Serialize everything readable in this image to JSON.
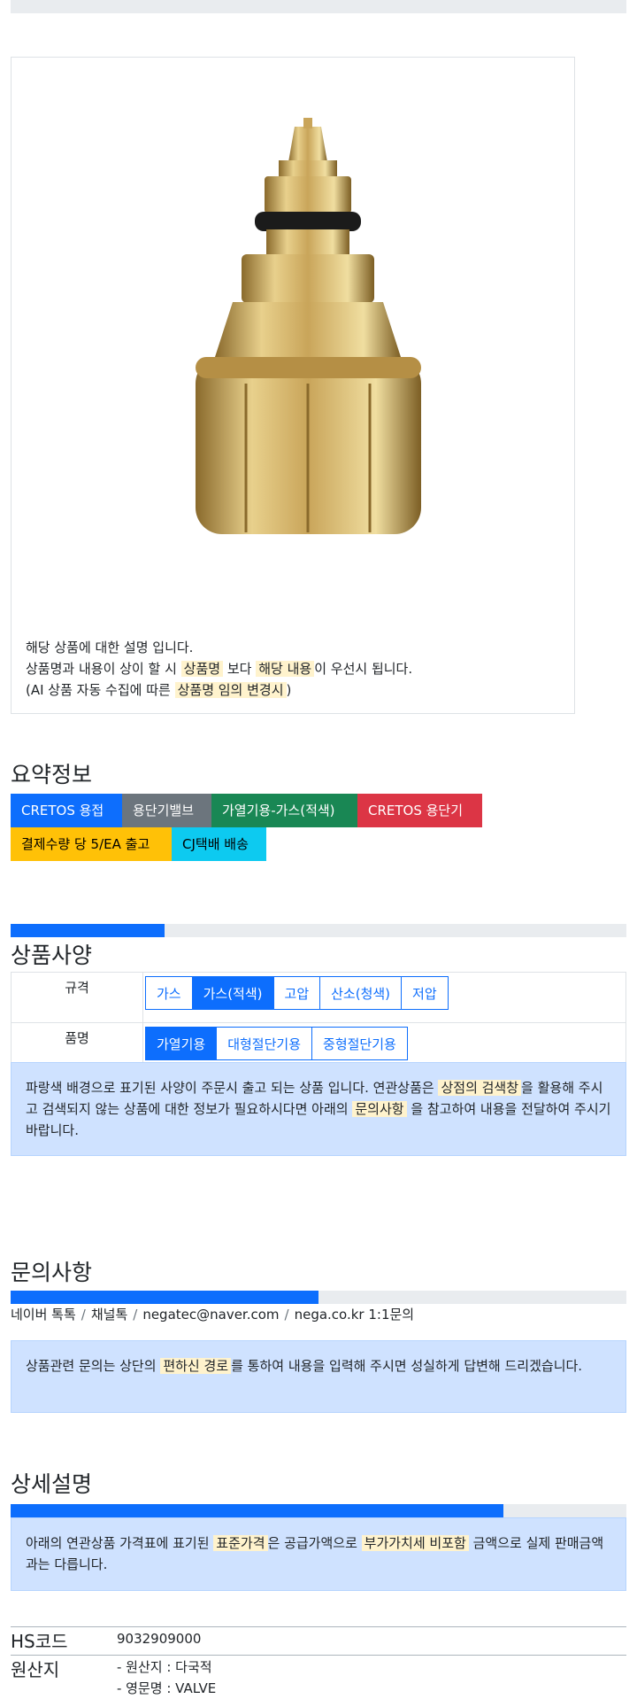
{
  "product": {
    "description_lines": {
      "line1": "해당 상품에 대한 설명 입니다.",
      "line2_pre": "상품명과 내용이 상이 할 시",
      "line2_hl1": "상품명",
      "line2_mid": "보다",
      "line2_hl2": "해당 내용",
      "line2_post": "이 우선시 됩니다.",
      "line3_pre": "(AI 상품 자동 수집에 따른",
      "line3_hl": "상품명 임의 변경시",
      "line3_post": ")"
    }
  },
  "summary": {
    "title": "요약정보",
    "badges": [
      "CRETOS 용접",
      "용단기밸브",
      "가열기용-가스(적색)",
      "CRETOS 용단기",
      "결제수량 당 5/EA 출고",
      "CJ택배 배송"
    ]
  },
  "specs": {
    "progress": 0.25,
    "title": "상품사양",
    "rows": [
      {
        "label": "규격",
        "options": [
          "가스",
          "가스(적색)",
          "고압",
          "산소(청색)",
          "저압"
        ],
        "active": 1
      },
      {
        "label": "품명",
        "options": [
          "가열기용",
          "대형절단기용",
          "중형절단기용"
        ],
        "active": 0
      }
    ],
    "notice_pre": "파랑색 배경으로 표기된 사양이 주문시 출고 되는 상품 입니다. 연관상품은",
    "notice_hl1": "상점의 검색창",
    "notice_mid": "을 활용해 주시고 검색되지 않는 상품에 대한 정보가 필요하시다면 아래의",
    "notice_hl2": "문의사항",
    "notice_post": "을 참고하여 내용을 전달하여 주시기 바랍니다."
  },
  "inquiry": {
    "title": "문의사항",
    "progress": 0.5,
    "channels": [
      "네이버 톡톡",
      "채널톡",
      "negatec@naver.com",
      "nega.co.kr 1:1문의"
    ],
    "separator": "/",
    "notice_pre": "상품관련 문의는 상단의",
    "notice_hl": "편하신 경로",
    "notice_post": "를 통하여 내용을 입력해 주시면 성실하게 답변해 드리겠습니다."
  },
  "detail": {
    "title": "상세설명",
    "progress": 0.8,
    "notice_pre": "아래의 연관상품 가격표에 표기된",
    "notice_hl1": "표준가격",
    "notice_mid": "은 공급가액으로",
    "notice_hl2": "부가가치세 비포함",
    "notice_post": "금액으로 실제 판매금액과는 다릅니다."
  },
  "info": {
    "hs_label": "HS코드",
    "hs_value": "9032909000",
    "origin_label": "원산지",
    "origin_line1": "- 원산지 : 다국적",
    "origin_line2": "- 영문명 : VALVE"
  }
}
